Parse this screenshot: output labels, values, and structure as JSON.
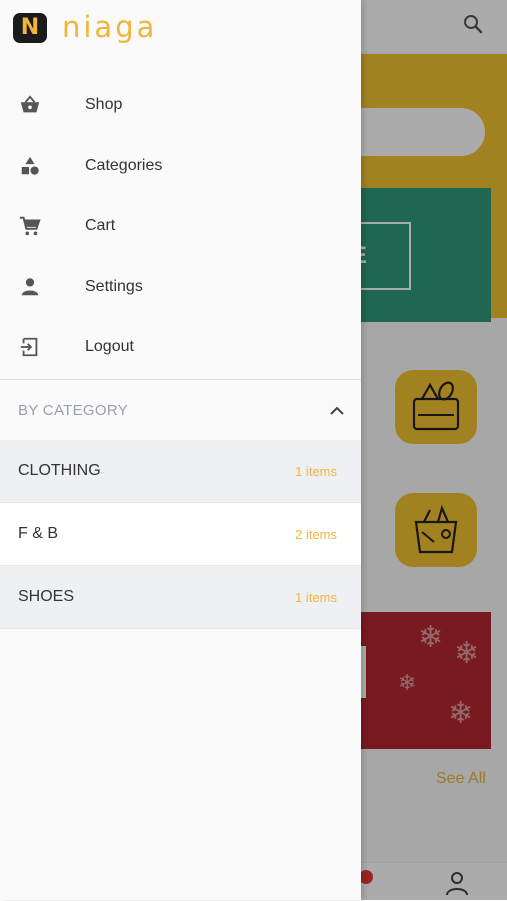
{
  "app": {
    "logo_letter": "N",
    "logo_text": "niaga"
  },
  "menu": {
    "items": [
      {
        "label": "Shop",
        "icon": "basket-icon"
      },
      {
        "label": "Categories",
        "icon": "shapes-icon"
      },
      {
        "label": "Cart",
        "icon": "cart-icon"
      },
      {
        "label": "Settings",
        "icon": "person-icon"
      },
      {
        "label": "Logout",
        "icon": "logout-icon"
      }
    ]
  },
  "categories": {
    "header": "BY CATEGORY",
    "items": [
      {
        "name": "CLOTHING",
        "count": "1 items"
      },
      {
        "name": "F & B",
        "count": "2 items"
      },
      {
        "name": "SHOES",
        "count": "1 items"
      }
    ]
  },
  "background": {
    "banner_letter": "E",
    "see_all": "See All"
  },
  "colors": {
    "accent": "#f0b63a",
    "banner": "#2f9a7a",
    "hero": "#f2c230",
    "xmas": "#b3282f"
  }
}
